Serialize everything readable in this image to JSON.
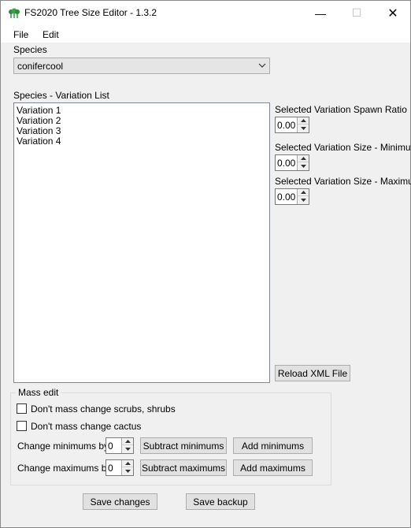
{
  "window": {
    "title": "FS2020 Tree Size Editor - 1.3.2",
    "minimize_glyph": "—",
    "maximize_glyph": "☐",
    "close_glyph": "✕"
  },
  "menu": {
    "file": "File",
    "edit": "Edit"
  },
  "species": {
    "label": "Species",
    "selected": "conifercool"
  },
  "variation_list": {
    "label": "Species - Variation List",
    "items": [
      "Variation 1",
      "Variation 2",
      "Variation 3",
      "Variation 4"
    ]
  },
  "fields": {
    "spawn_ratio": {
      "label": "Selected Variation Spawn Ratio",
      "value": "0.00"
    },
    "size_min": {
      "label": "Selected Variation Size - Minimum",
      "value": "0.00"
    },
    "size_max": {
      "label": "Selected Variation Size - Maximum",
      "value": "0.00"
    }
  },
  "reload_button": "Reload XML File",
  "mass_edit": {
    "title": "Mass edit",
    "checkbox_scrubs": "Don't mass change scrubs, shrubs",
    "checkbox_cactus": "Don't mass change cactus",
    "change_min_label": "Change minimums by:",
    "change_min_value": "0",
    "subtract_min": "Subtract minimums",
    "add_min": "Add minimums",
    "change_max_label": "Change maximums by:",
    "change_max_value": "0",
    "subtract_max": "Subtract maximums",
    "add_max": "Add maximums"
  },
  "footer": {
    "save_changes": "Save changes",
    "save_backup": "Save backup"
  },
  "colors": {
    "app_icon": "#2e8b3a",
    "button_face": "#e1e1e1",
    "window_bg": "#f0f0f0"
  }
}
